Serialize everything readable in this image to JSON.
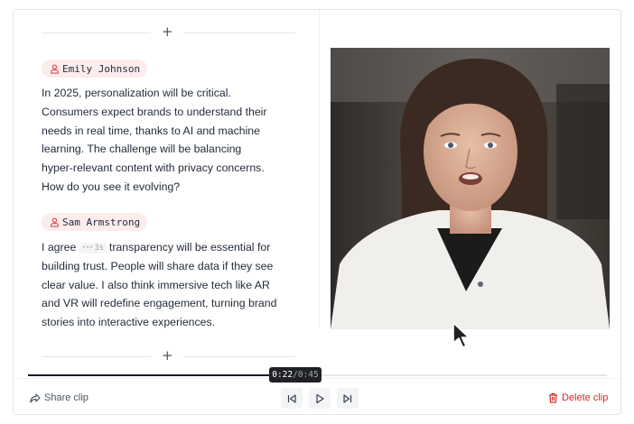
{
  "speakers": {
    "first": {
      "name": "Emily Johnson",
      "icon": "user-icon"
    },
    "second": {
      "name": "Sam Armstrong",
      "icon": "user-icon"
    }
  },
  "transcript": {
    "para1_lines": [
      "In 2025, personalization will be critical.",
      "Consumers expect brands to understand their",
      "needs in real time, thanks to AI and machine",
      "learning. The challenge will be balancing",
      "hyper-relevant content with privacy concerns.",
      "How do you see it evolving?"
    ],
    "para2_start": "I agree",
    "pause_marker": "3s",
    "para2_first_rest": "transparency will be essential for",
    "para2_lines": [
      "building trust. People will share data if they see",
      "clear value. I also think immersive tech like AR",
      "and VR will redefine engagement, turning brand",
      "stories into interactive experiences."
    ]
  },
  "separator_symbol": "+",
  "player": {
    "current_time": "0:22",
    "separator": "/",
    "total_time": "0:45",
    "progress_fraction": 0.489
  },
  "actions": {
    "share_label": "Share clip",
    "delete_label": "Delete clip"
  },
  "colors": {
    "speaker_badge_bg": "#fdecec",
    "speaker_icon": "#e04848",
    "delete": "#dc2626",
    "time_badge_bg": "#1f2124"
  }
}
